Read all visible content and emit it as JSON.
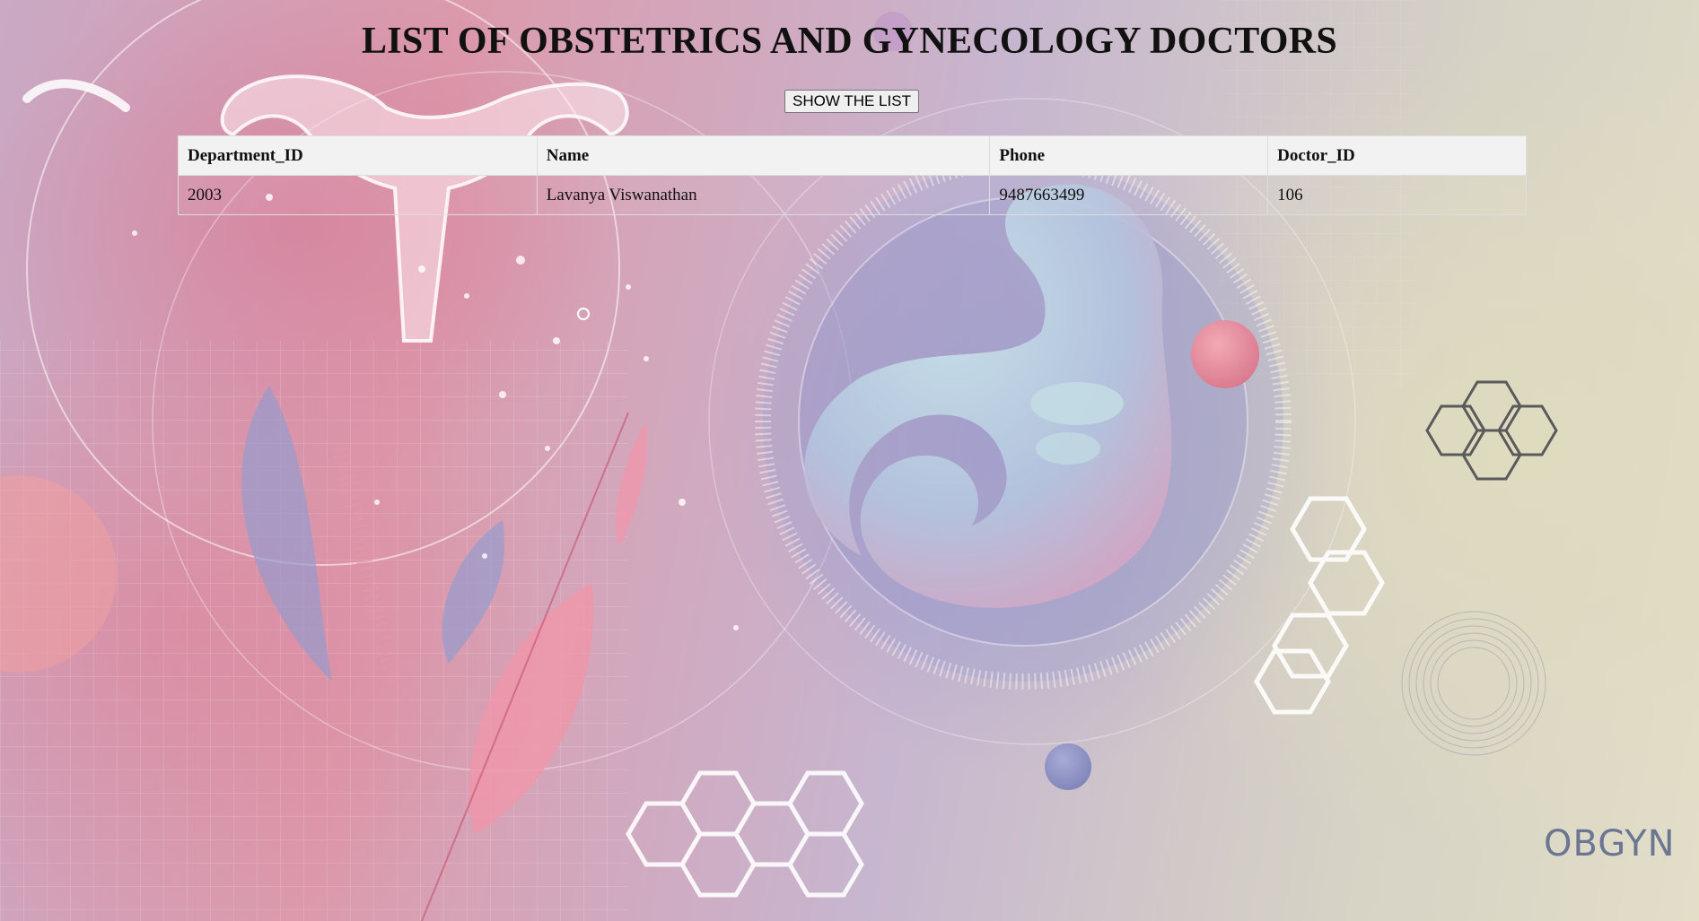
{
  "page": {
    "title": "LIST OF OBSTETRICS AND GYNECOLOGY DOCTORS",
    "show_button_label": "SHOW THE LIST"
  },
  "table": {
    "columns": [
      "Department_ID",
      "Name",
      "Phone",
      "Doctor_ID"
    ],
    "rows": [
      [
        "2003",
        "Lavanya Viswanathan",
        "9487663499",
        "106"
      ]
    ]
  },
  "background": {
    "watermark_text": "OBGYN",
    "colors": {
      "pink": "#dc9aac",
      "lavender": "#b8b6d6",
      "cream": "#e2dec8",
      "header_bg": "#f2f2f2"
    }
  }
}
